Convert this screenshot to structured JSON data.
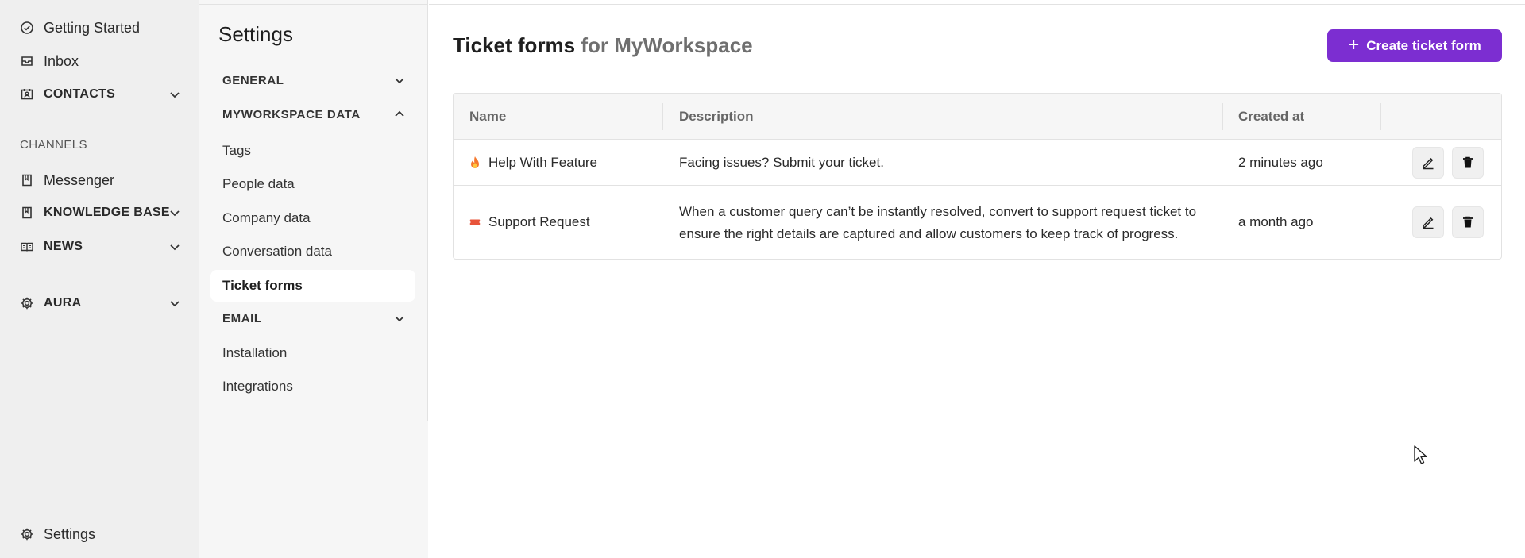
{
  "sidebar": {
    "items": [
      {
        "label": "Getting Started",
        "icon": "check-circle-icon"
      },
      {
        "label": "Inbox",
        "icon": "inbox-icon"
      },
      {
        "label": "CONTACTS",
        "icon": "contacts-icon"
      }
    ],
    "channels_label": "CHANNELS",
    "channel_items": [
      {
        "label": "Messenger",
        "icon": "book-icon"
      },
      {
        "label": "KNOWLEDGE BASE",
        "icon": "book-icon"
      },
      {
        "label": "NEWS",
        "icon": "news-icon"
      }
    ],
    "aura_label": "AURA",
    "settings_label": "Settings"
  },
  "subnav": {
    "title": "Settings",
    "groups": {
      "general": "GENERAL",
      "workspace_data": "MYWORKSPACE DATA",
      "email": "EMAIL"
    },
    "links": [
      "Tags",
      "People data",
      "Company data",
      "Conversation data"
    ],
    "active": "Ticket forms",
    "bottom_links": [
      "Installation",
      "Integrations"
    ]
  },
  "main": {
    "title": "Ticket forms",
    "title_suffix": "for MyWorkspace",
    "create_button": "Create ticket form",
    "table": {
      "headers": [
        "Name",
        "Description",
        "Created at"
      ],
      "rows": [
        {
          "name": "Help With Feature",
          "emoji": "fire-icon",
          "description": "Facing issues? Submit your ticket.",
          "created_at": "2 minutes ago"
        },
        {
          "name": "Support Request",
          "emoji": "ticket-icon",
          "description": "When a customer query can’t be instantly resolved, convert to support request ticket to ensure the right details are captured and allow customers to keep track of progress.",
          "created_at": "a month ago"
        }
      ]
    }
  },
  "colors": {
    "accent": "#7c2ed1",
    "sidebar_bg": "#efefef",
    "subnav_bg": "#f6f6f6"
  }
}
